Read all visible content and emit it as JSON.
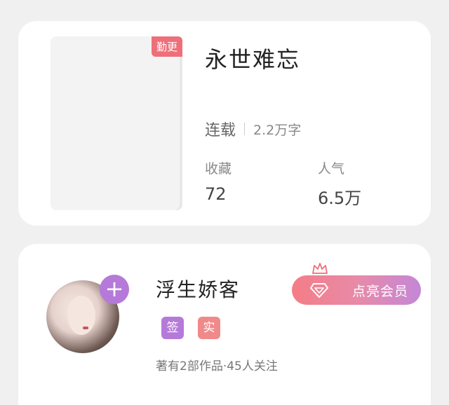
{
  "book": {
    "badge": "勤更",
    "title": "永世难忘",
    "status": "连载",
    "word_count": "2.2万字",
    "stats": {
      "favorites_label": "收藏",
      "favorites_value": "72",
      "popularity_label": "人气",
      "popularity_value": "6.5万"
    }
  },
  "author": {
    "name": "浮生娇客",
    "follow_symbol": "+",
    "tags": {
      "signed": "签",
      "verified": "实"
    },
    "info": "著有2部作品·45人关注",
    "vip_label": "点亮会员"
  },
  "colors": {
    "badge_red": "#ee6f7a",
    "purple": "#b57ad9",
    "pink": "#f08a8a",
    "vip_gradient_start": "#f47d86",
    "vip_gradient_end": "#c487d8"
  }
}
